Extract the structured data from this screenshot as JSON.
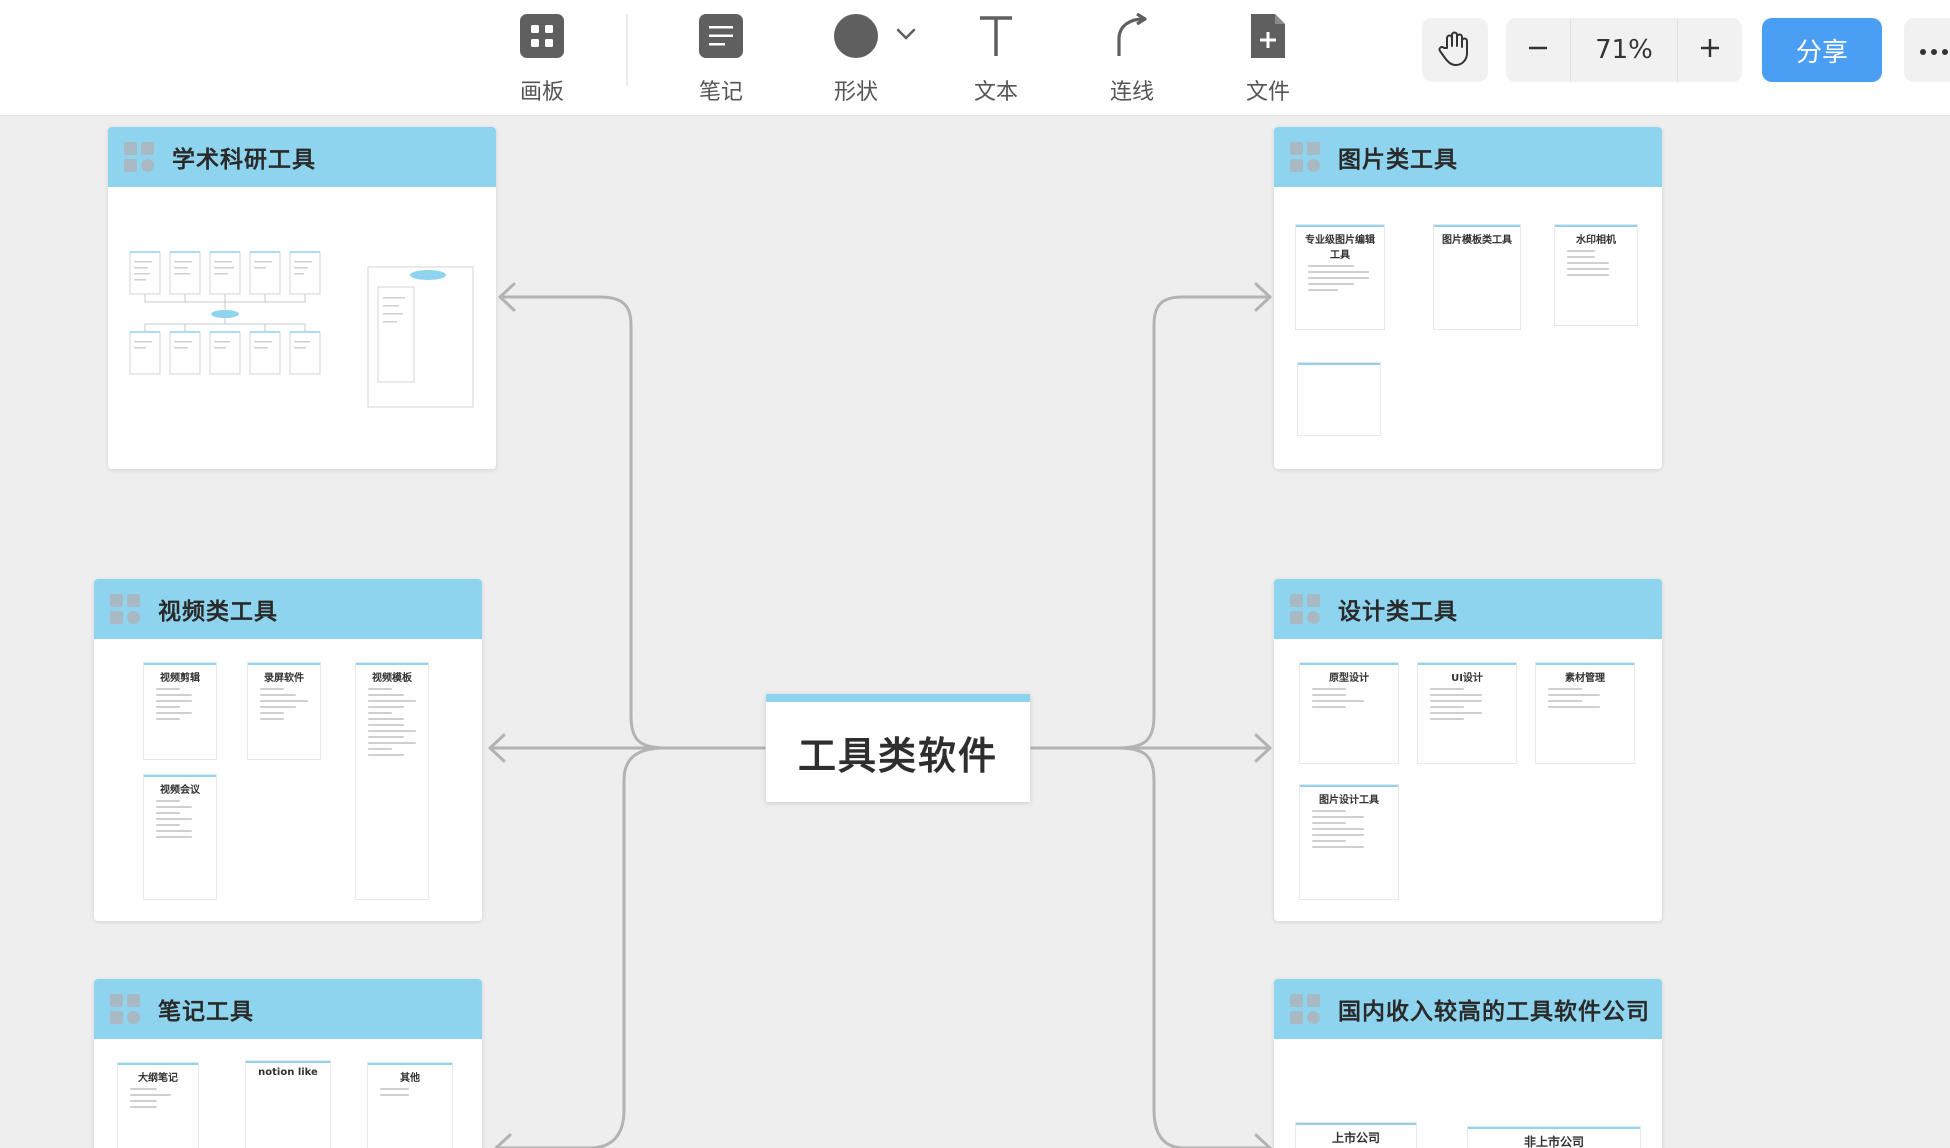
{
  "toolbar": {
    "tools": [
      {
        "label": "画板",
        "icon": "board-icon"
      },
      {
        "label": "笔记",
        "icon": "note-icon"
      },
      {
        "label": "形状",
        "icon": "circle-shape-icon"
      },
      {
        "label": "文本",
        "icon": "text-icon"
      },
      {
        "label": "连线",
        "icon": "connector-icon"
      },
      {
        "label": "文件",
        "icon": "add-file-icon"
      }
    ],
    "zoom": "71%",
    "share_label": "分享",
    "accent_color": "#4a9ff5"
  },
  "canvas": {
    "center_title": "工具类软件",
    "frames": [
      {
        "title": "学术科研工具",
        "notes": []
      },
      {
        "title": "图片类工具",
        "notes": [
          "专业级图片编辑工具",
          "图片模板类工具",
          "水印相机"
        ]
      },
      {
        "title": "视频类工具",
        "notes": [
          "视频剪辑",
          "录屏软件",
          "视频模板",
          "视频会议"
        ]
      },
      {
        "title": "设计类工具",
        "notes": [
          "原型设计",
          "UI设计",
          "素材管理",
          "图片设计工具"
        ]
      },
      {
        "title": "笔记工具",
        "notes": [
          "大纲笔记",
          "notion like",
          "其他"
        ]
      },
      {
        "title": "国内收入较高的工具软件公司",
        "notes": [
          "上市公司",
          "非上市公司"
        ]
      }
    ],
    "frame_header_color": "#8fd4ee"
  }
}
